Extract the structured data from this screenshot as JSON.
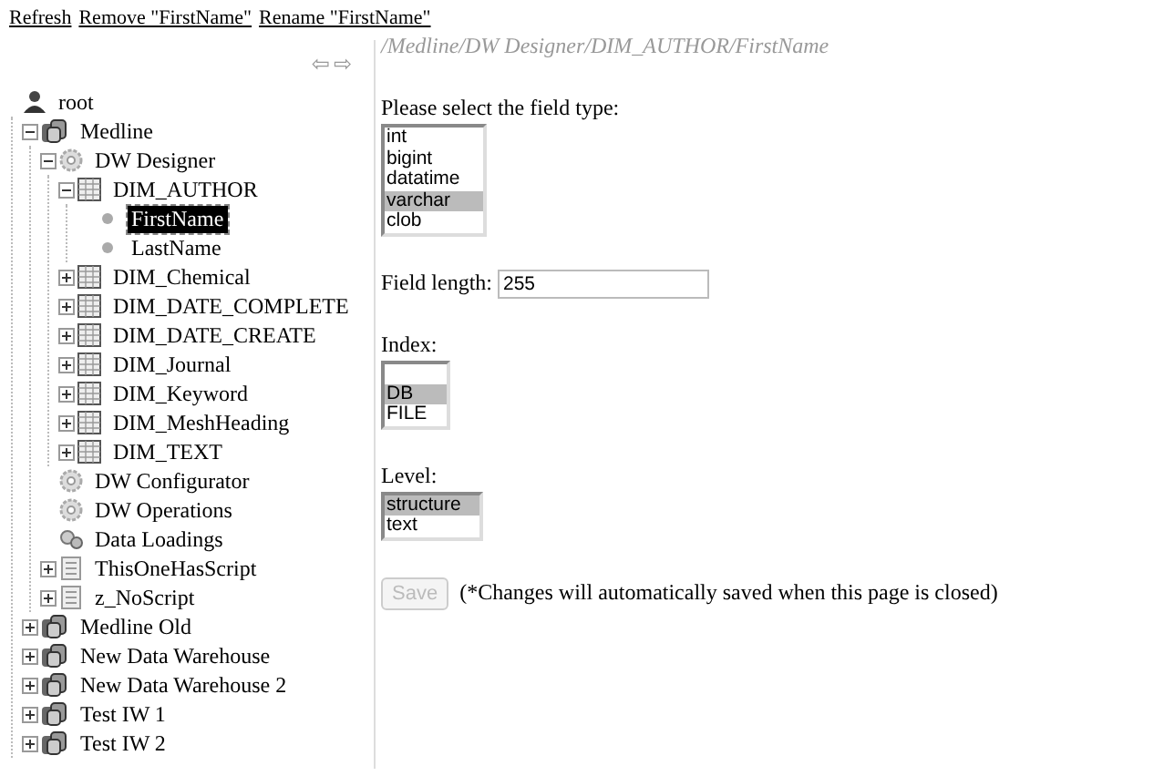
{
  "toolbar_links": [
    "Refresh",
    "Remove \"FirstName\"",
    "Rename \"FirstName\""
  ],
  "nav_arrows": [
    "⇦",
    "⇨"
  ],
  "tree": [
    {
      "label": "root",
      "kind": "root",
      "selected": false,
      "children": [
        {
          "label": "Medline",
          "kind": "database",
          "expanded": true,
          "selected": false,
          "children": [
            {
              "label": "DW Designer",
              "kind": "designer",
              "expanded": true,
              "selected": false,
              "children": [
                {
                  "label": "DIM_AUTHOR",
                  "kind": "table",
                  "expanded": true,
                  "selected": false,
                  "children": [
                    {
                      "label": "FirstName",
                      "kind": "field",
                      "selected": true
                    },
                    {
                      "label": "LastName",
                      "kind": "field",
                      "selected": false
                    }
                  ]
                },
                {
                  "label": "DIM_Chemical",
                  "kind": "table",
                  "expanded": false,
                  "selected": false
                },
                {
                  "label": "DIM_DATE_COMPLETE",
                  "kind": "table",
                  "expanded": false,
                  "selected": false
                },
                {
                  "label": "DIM_DATE_CREATE",
                  "kind": "table",
                  "expanded": false,
                  "selected": false
                },
                {
                  "label": "DIM_Journal",
                  "kind": "table",
                  "expanded": false,
                  "selected": false
                },
                {
                  "label": "DIM_Keyword",
                  "kind": "table",
                  "expanded": false,
                  "selected": false
                },
                {
                  "label": "DIM_MeshHeading",
                  "kind": "table",
                  "expanded": false,
                  "selected": false
                },
                {
                  "label": "DIM_TEXT",
                  "kind": "table",
                  "expanded": false,
                  "selected": false
                }
              ]
            },
            {
              "label": "DW Configurator",
              "kind": "designer",
              "selected": false
            },
            {
              "label": "DW Operations",
              "kind": "designer",
              "selected": false
            },
            {
              "label": "Data Loadings",
              "kind": "loadings",
              "selected": false
            },
            {
              "label": "ThisOneHasScript",
              "kind": "script",
              "expanded": false,
              "selected": false
            },
            {
              "label": "z_NoScript",
              "kind": "script",
              "expanded": false,
              "selected": false
            }
          ]
        },
        {
          "label": "Medline Old",
          "kind": "database",
          "expanded": false,
          "selected": false
        },
        {
          "label": "New Data Warehouse",
          "kind": "database",
          "expanded": false,
          "selected": false
        },
        {
          "label": "New Data Warehouse 2",
          "kind": "database",
          "expanded": false,
          "selected": false
        },
        {
          "label": "Test IW 1",
          "kind": "database",
          "expanded": false,
          "selected": false
        },
        {
          "label": "Test IW 2",
          "kind": "database",
          "expanded": false,
          "selected": false
        }
      ]
    }
  ],
  "path": "/Medline/DW Designer/DIM_AUTHOR/FirstName",
  "field_type": {
    "label": "Please select the field type:",
    "options": [
      {
        "label": "int",
        "selected": false
      },
      {
        "label": "bigint",
        "selected": false
      },
      {
        "label": "datatime",
        "selected": false
      },
      {
        "label": "varchar",
        "selected": true
      },
      {
        "label": "clob",
        "selected": false
      }
    ]
  },
  "field_length": {
    "label": "Field length:",
    "value": "255"
  },
  "index": {
    "label": "Index:",
    "options": [
      {
        "label": "DB",
        "selected": true
      },
      {
        "label": "FILE",
        "selected": false
      }
    ]
  },
  "level": {
    "label": "Level:",
    "options": [
      {
        "label": "structure",
        "selected": true
      },
      {
        "label": "text",
        "selected": false
      }
    ]
  },
  "save_button": {
    "label": "Save",
    "disabled": true
  },
  "note": "(*Changes will automatically saved when this page is closed)"
}
